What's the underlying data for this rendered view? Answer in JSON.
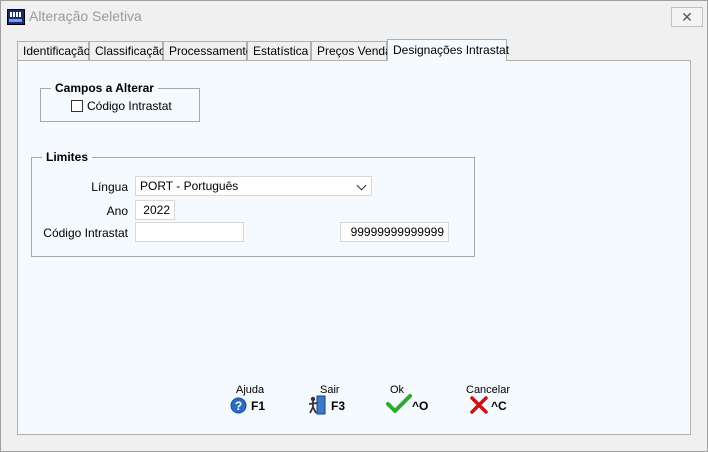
{
  "window": {
    "title": "Alteração Seletiva",
    "close_label": "✕"
  },
  "tabs": [
    {
      "label": "Identificação"
    },
    {
      "label": "Classificação"
    },
    {
      "label": "Processamento"
    },
    {
      "label": "Estatística"
    },
    {
      "label": "Preços Venda"
    },
    {
      "label": "Designações Intrastat",
      "active": true
    }
  ],
  "campos": {
    "legend": "Campos a Alterar",
    "codigo_intrastat_label": "Código Intrastat",
    "codigo_intrastat_checked": false
  },
  "limites": {
    "legend": "Limites",
    "lingua_label": "Língua",
    "lingua_value": "PORT - Português",
    "ano_label": "Ano",
    "ano_value": "2022",
    "codigo_label": "Código Intrastat",
    "codigo_from": "",
    "codigo_to": "99999999999999"
  },
  "actions": [
    {
      "label": "Ajuda",
      "key": "F1",
      "icon": "help-icon"
    },
    {
      "label": "Sair",
      "key": "F3",
      "icon": "exit-door-icon"
    },
    {
      "label": "Ok",
      "key": "^O",
      "icon": "checkmark-icon"
    },
    {
      "label": "Cancelar",
      "key": "^C",
      "icon": "cancel-x-icon"
    }
  ],
  "colors": {
    "panel_bg": "#f5fafe",
    "ok_green": "#2eaa2e",
    "cancel_red": "#d21010",
    "help_blue": "#2b6cc4"
  }
}
